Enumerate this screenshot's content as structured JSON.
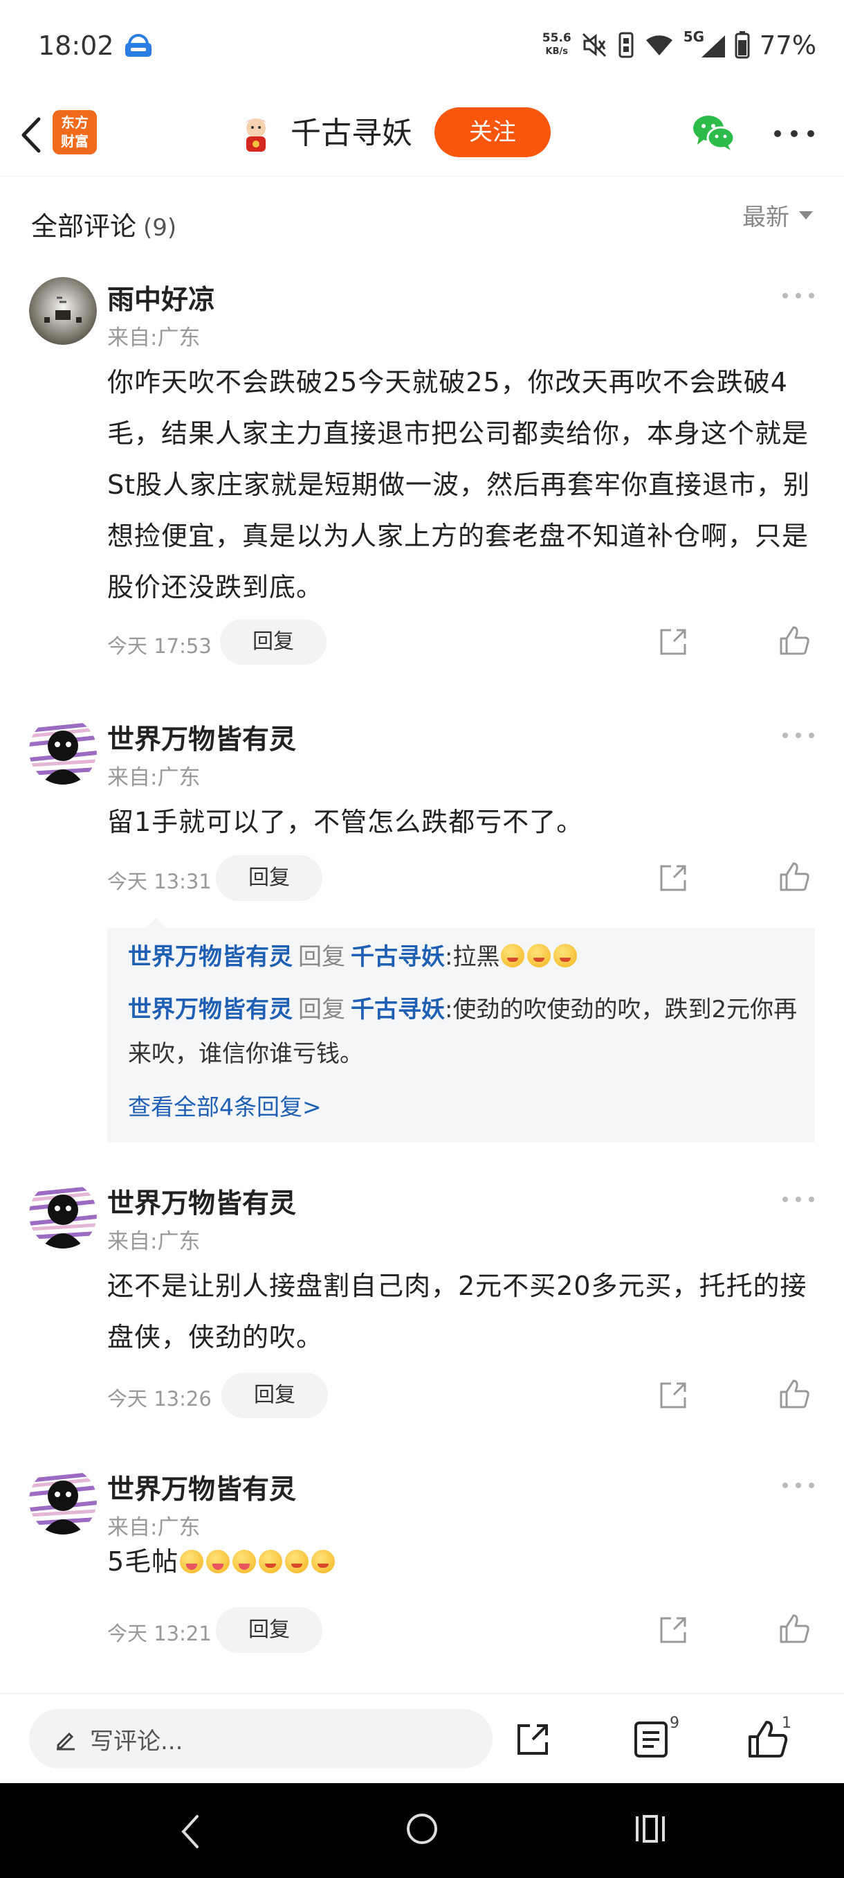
{
  "status_bar": {
    "time": "18:02",
    "net_speed_value": "55.6",
    "net_speed_unit": "KB/s",
    "network": "5G",
    "battery": "77%"
  },
  "header": {
    "logo_line1": "东方",
    "logo_line2": "财富",
    "author_name": "千古寻妖",
    "follow_label": "关注",
    "accent_color": "#f8550d"
  },
  "comments_header": {
    "title": "全部评论",
    "count": "(9)",
    "sort_label": "最新"
  },
  "comments": [
    {
      "username": "雨中好凉",
      "location": "来自:广东",
      "text": "你咋天吹不会跌破25今天就破25，你改天再吹不会跌破4毛，结果人家主力直接退市把公司都卖给你，本身这个就是St股人家庄家就是短期做一波，然后再套牢你直接退市，别想捡便宜，真是以为人家上方的套老盘不知道补仓啊，只是股价还没跌到底。",
      "time": "今天 17:53",
      "reply_label": "回复"
    },
    {
      "username": "世界万物皆有灵",
      "location": "来自:广东",
      "text": "留1手就可以了，不管怎么跌都亏不了。",
      "time": "今天 13:31",
      "reply_label": "回复",
      "replies": [
        {
          "user": "世界万物皆有灵",
          "verb": "回复",
          "target": "千古寻妖",
          "text": ":拉黑"
        },
        {
          "user": "世界万物皆有灵",
          "verb": "回复",
          "target": "千古寻妖",
          "text": ":使劲的吹使劲的吹，跌到2元你再来吹，谁信你谁亏钱。"
        }
      ],
      "view_all": "查看全部4条回复>"
    },
    {
      "username": "世界万物皆有灵",
      "location": "来自:广东",
      "text": "还不是让别人接盘割自己肉，2元不买20多元买，托托的接盘侠，侠劲的吹。",
      "time": "今天 13:26",
      "reply_label": "回复"
    },
    {
      "username": "世界万物皆有灵",
      "location": "来自:广东",
      "text": "5毛帖",
      "time": "今天 13:21",
      "reply_label": "回复"
    }
  ],
  "bottom_bar": {
    "input_placeholder": "写评论...",
    "comment_count": "9",
    "like_count": "1"
  }
}
